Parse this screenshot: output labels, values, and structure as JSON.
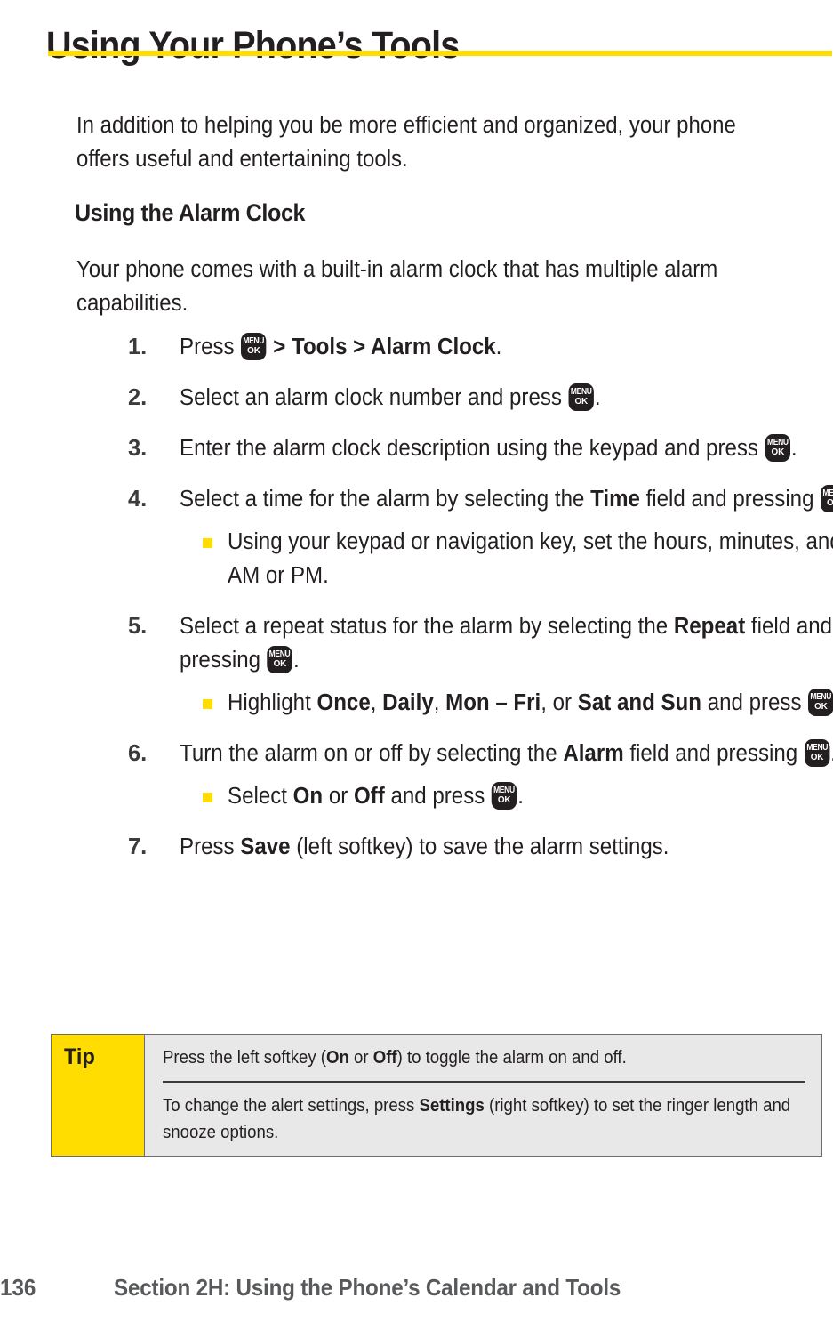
{
  "page": {
    "title": "Using Your Phone’s Tools",
    "accent_color": "#FFDD00",
    "text_color": "#231f20"
  },
  "intro": "In addition to helping you be more efficient and organized, your phone offers useful and entertaining tools.",
  "section": {
    "heading": "Using the Alarm Clock",
    "lead": "Your phone comes with a built-in alarm clock that has multiple alarm capabilities."
  },
  "menu_key": {
    "top": "MENU",
    "bottom": "OK",
    "name": "menu-ok-key-icon"
  },
  "steps": [
    {
      "number": "1.",
      "parts": [
        {
          "t": "text",
          "v": "Press "
        },
        {
          "t": "key"
        },
        {
          "t": "bold",
          "v": " > Tools > Alarm Clock"
        },
        {
          "t": "text",
          "v": "."
        }
      ]
    },
    {
      "number": "2.",
      "parts": [
        {
          "t": "text",
          "v": "Select an alarm clock number and press "
        },
        {
          "t": "key"
        },
        {
          "t": "text",
          "v": "."
        }
      ]
    },
    {
      "number": "3.",
      "parts": [
        {
          "t": "text",
          "v": "Enter the alarm clock description using the keypad and press "
        },
        {
          "t": "key"
        },
        {
          "t": "text",
          "v": "."
        }
      ]
    },
    {
      "number": "4.",
      "parts": [
        {
          "t": "text",
          "v": "Select a time for the alarm by selecting the "
        },
        {
          "t": "bold",
          "v": "Time"
        },
        {
          "t": "text",
          "v": " field and pressing "
        },
        {
          "t": "key"
        },
        {
          "t": "text",
          "v": "."
        }
      ],
      "subitems": [
        {
          "parts": [
            {
              "t": "text",
              "v": "Using your keypad or navigation key, set the hours, minutes, and AM or PM."
            }
          ]
        }
      ]
    },
    {
      "number": "5.",
      "parts": [
        {
          "t": "text",
          "v": "Select a repeat status for the alarm by selecting the "
        },
        {
          "t": "bold",
          "v": "Repeat"
        },
        {
          "t": "text",
          "v": " field and pressing "
        },
        {
          "t": "key"
        },
        {
          "t": "text",
          "v": "."
        }
      ],
      "subitems": [
        {
          "parts": [
            {
              "t": "text",
              "v": "Highlight "
            },
            {
              "t": "bold",
              "v": "Once"
            },
            {
              "t": "text",
              "v": ", "
            },
            {
              "t": "bold",
              "v": "Daily"
            },
            {
              "t": "text",
              "v": ", "
            },
            {
              "t": "bold",
              "v": "Mon – Fri"
            },
            {
              "t": "text",
              "v": ", or "
            },
            {
              "t": "bold",
              "v": "Sat and Sun"
            },
            {
              "t": "text",
              "v": " and press "
            },
            {
              "t": "key"
            },
            {
              "t": "text",
              "v": "."
            }
          ]
        }
      ]
    },
    {
      "number": "6.",
      "parts": [
        {
          "t": "text",
          "v": "Turn the alarm on or off by selecting the "
        },
        {
          "t": "bold",
          "v": "Alarm"
        },
        {
          "t": "text",
          "v": " field and pressing "
        },
        {
          "t": "key"
        },
        {
          "t": "text",
          "v": "."
        }
      ],
      "subitems": [
        {
          "parts": [
            {
              "t": "text",
              "v": "Select "
            },
            {
              "t": "bold",
              "v": "On"
            },
            {
              "t": "text",
              "v": " or "
            },
            {
              "t": "bold",
              "v": "Off"
            },
            {
              "t": "text",
              "v": " and press "
            },
            {
              "t": "key"
            },
            {
              "t": "text",
              "v": "."
            }
          ]
        }
      ]
    },
    {
      "number": "7.",
      "parts": [
        {
          "t": "text",
          "v": "Press "
        },
        {
          "t": "bold",
          "v": "Save"
        },
        {
          "t": "text",
          "v": " (left softkey) to save the alarm settings."
        }
      ]
    }
  ],
  "tip": {
    "label": "Tip",
    "rows": [
      [
        {
          "t": "text",
          "v": "Press the left softkey ("
        },
        {
          "t": "bold",
          "v": "On"
        },
        {
          "t": "text",
          "v": " or "
        },
        {
          "t": "bold",
          "v": "Off"
        },
        {
          "t": "text",
          "v": ") to toggle the alarm on and off."
        }
      ],
      [
        {
          "t": "text",
          "v": "To change the alert settings, press "
        },
        {
          "t": "bold",
          "v": "Settings"
        },
        {
          "t": "text",
          "v": " (right softkey) to set the ringer length and snooze options."
        }
      ]
    ]
  },
  "footer": {
    "page_number": "136",
    "section_text": "Section 2H: Using the Phone’s Calendar and Tools"
  }
}
